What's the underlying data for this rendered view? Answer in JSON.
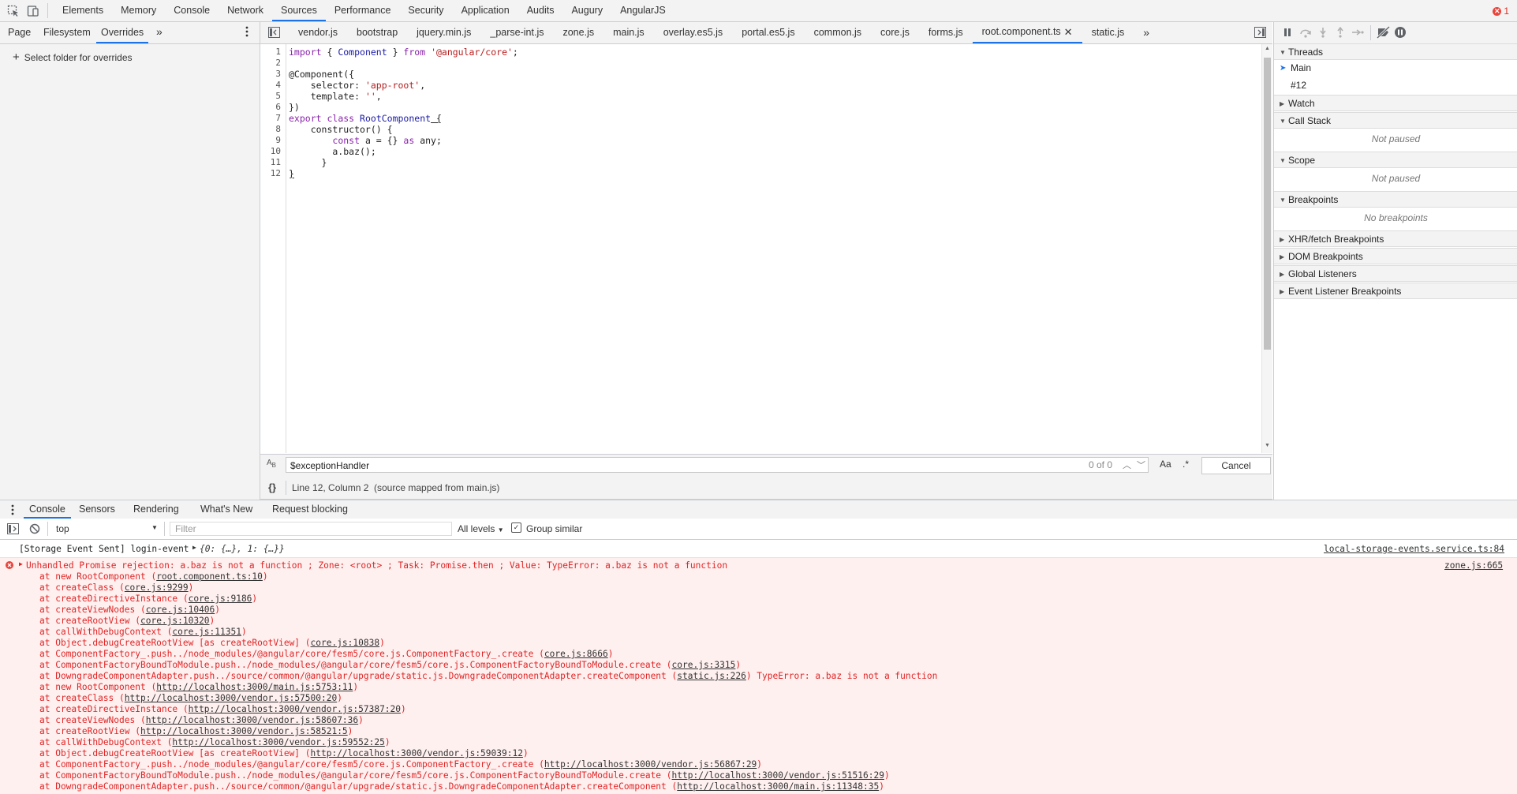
{
  "devtools": {
    "main_tabs": [
      "Elements",
      "Memory",
      "Console",
      "Network",
      "Sources",
      "Performance",
      "Security",
      "Application",
      "Audits",
      "Augury",
      "AngularJS"
    ],
    "active_main_tab": "Sources",
    "error_count": "1"
  },
  "navigator": {
    "tabs": [
      "Page",
      "Filesystem",
      "Overrides"
    ],
    "active_tab": "Overrides",
    "select_folder": "Select folder for overrides"
  },
  "editor": {
    "tabs": [
      "vendor.js",
      "bootstrap",
      "jquery.min.js",
      "_parse-int.js",
      "zone.js",
      "main.js",
      "overlay.es5.js",
      "portal.es5.js",
      "common.js",
      "core.js",
      "forms.js",
      "root.component.ts",
      "static.js"
    ],
    "active_tab": "root.component.ts",
    "line_numbers": [
      "1",
      "2",
      "3",
      "4",
      "5",
      "6",
      "7",
      "8",
      "9",
      "10",
      "11",
      "12"
    ],
    "search_value": "$exceptionHandler",
    "match_count": "0 of 0",
    "match_case_label": "Aa",
    "regex_label": ".*",
    "cancel_label": "Cancel",
    "status_position": "Line 12, Column 2",
    "status_source": "(source mapped from main.js)",
    "pretty_print_label": "{}"
  },
  "debugger": {
    "sections": {
      "threads": "Threads",
      "thread_main": "Main",
      "thread_12": "#12",
      "watch": "Watch",
      "call_stack": "Call Stack",
      "call_stack_empty": "Not paused",
      "scope": "Scope",
      "scope_empty": "Not paused",
      "breakpoints": "Breakpoints",
      "breakpoints_empty": "No breakpoints",
      "xhr": "XHR/fetch Breakpoints",
      "dom": "DOM Breakpoints",
      "global": "Global Listeners",
      "event": "Event Listener Breakpoints"
    }
  },
  "drawer": {
    "tabs": [
      "Console",
      "Sensors",
      "Rendering",
      "What's New",
      "Request blocking"
    ],
    "active_tab": "Console",
    "context": "top",
    "filter_placeholder": "Filter",
    "levels": "All levels",
    "group_similar": "Group similar"
  },
  "console": {
    "msg1": {
      "text": "[Storage Event Sent] login-event",
      "obj": "{0: {…}, 1: {…}}",
      "source": "local-storage-events.service.ts:84"
    },
    "msg2": {
      "text": "Unhandled Promise rejection: a.baz is not a function ; Zone: <root> ; Task: Promise.then ; Value: TypeError: a.baz is not a function",
      "source": "zone.js:665",
      "frames": [
        {
          "pre": "at new RootComponent (",
          "link": "root.component.ts:10",
          "post": ")"
        },
        {
          "pre": "at createClass (",
          "link": "core.js:9299",
          "post": ")"
        },
        {
          "pre": "at createDirectiveInstance (",
          "link": "core.js:9186",
          "post": ")"
        },
        {
          "pre": "at createViewNodes (",
          "link": "core.js:10406",
          "post": ")"
        },
        {
          "pre": "at createRootView (",
          "link": "core.js:10320",
          "post": ")"
        },
        {
          "pre": "at callWithDebugContext (",
          "link": "core.js:11351",
          "post": ")"
        },
        {
          "pre": "at Object.debugCreateRootView [as createRootView] (",
          "link": "core.js:10838",
          "post": ")"
        },
        {
          "pre": "at ComponentFactory_.push../node_modules/@angular/core/fesm5/core.js.ComponentFactory_.create (",
          "link": "core.js:8666",
          "post": ")"
        },
        {
          "pre": "at ComponentFactoryBoundToModule.push../node_modules/@angular/core/fesm5/core.js.ComponentFactoryBoundToModule.create (",
          "link": "core.js:3315",
          "post": ")"
        },
        {
          "pre": "at DowngradeComponentAdapter.push../source/common/@angular/upgrade/static.js.DowngradeComponentAdapter.createComponent (",
          "link": "static.js:226",
          "post": ") TypeError: a.baz is not a function"
        },
        {
          "pre": "at new RootComponent (",
          "link": "http://localhost:3000/main.js:5753:11",
          "post": ")"
        },
        {
          "pre": "at createClass (",
          "link": "http://localhost:3000/vendor.js:57500:20",
          "post": ")"
        },
        {
          "pre": "at createDirectiveInstance (",
          "link": "http://localhost:3000/vendor.js:57387:20",
          "post": ")"
        },
        {
          "pre": "at createViewNodes (",
          "link": "http://localhost:3000/vendor.js:58607:36",
          "post": ")"
        },
        {
          "pre": "at createRootView (",
          "link": "http://localhost:3000/vendor.js:58521:5",
          "post": ")"
        },
        {
          "pre": "at callWithDebugContext (",
          "link": "http://localhost:3000/vendor.js:59552:25",
          "post": ")"
        },
        {
          "pre": "at Object.debugCreateRootView [as createRootView] (",
          "link": "http://localhost:3000/vendor.js:59039:12",
          "post": ")"
        },
        {
          "pre": "at ComponentFactory_.push../node_modules/@angular/core/fesm5/core.js.ComponentFactory_.create (",
          "link": "http://localhost:3000/vendor.js:56867:29",
          "post": ")"
        },
        {
          "pre": "at ComponentFactoryBoundToModule.push../node_modules/@angular/core/fesm5/core.js.ComponentFactoryBoundToModule.create (",
          "link": "http://localhost:3000/vendor.js:51516:29",
          "post": ")"
        },
        {
          "pre": "at DowngradeComponentAdapter.push../source/common/@angular/upgrade/static.js.DowngradeComponentAdapter.createComponent (",
          "link": "http://localhost:3000/main.js:11348:35",
          "post": ")"
        }
      ]
    }
  },
  "code_tokens": {
    "l1a": "import",
    "l1b": " { ",
    "l1c": "Component",
    "l1d": " } ",
    "l1e": "from",
    "l1f": " ",
    "l1g": "'@angular/core'",
    "l1h": ";",
    "l3": "@Component({",
    "l4a": "    selector: ",
    "l4b": "'app-root'",
    "l4c": ",",
    "l5a": "    template: ",
    "l5b": "''",
    "l5c": ",",
    "l6": "})",
    "l7a": "export",
    "l7b": " ",
    "l7c": "class",
    "l7d": " ",
    "l7e": "RootComponent",
    "l7f": " {",
    "l8": "    constructor() {",
    "l9a": "        ",
    "l9b": "const",
    "l9c": " a = {} ",
    "l9d": "as",
    "l9e": " any;",
    "l10": "        a.baz();",
    "l11": "      }",
    "l12": "}"
  },
  "colors": {
    "accent": "#1a73e8",
    "error_text": "#e02424",
    "error_bg": "#fff0f0"
  }
}
